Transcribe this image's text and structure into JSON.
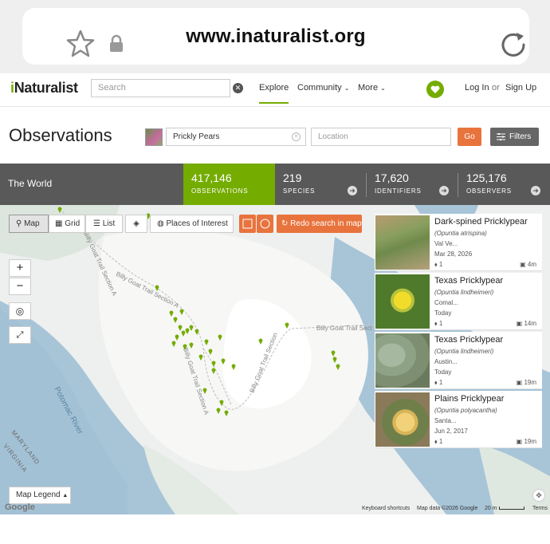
{
  "browser": {
    "url": "www.inaturalist.org"
  },
  "nav": {
    "logo_i": "i",
    "logo_rest": "Naturalist",
    "search_placeholder": "Search",
    "explore": "Explore",
    "community": "Community",
    "more": "More",
    "login": "Log In",
    "or": "or",
    "signup": "Sign Up"
  },
  "header": {
    "title": "Observations",
    "taxon_value": "Prickly Pears",
    "location_placeholder": "Location",
    "go": "Go",
    "filters": "Filters"
  },
  "stats": {
    "place": "The World",
    "observations": {
      "count": "417,146",
      "label": "OBSERVATIONS"
    },
    "species": {
      "count": "219",
      "label": "SPECIES"
    },
    "identifiers": {
      "count": "17,620",
      "label": "IDENTIFIERS"
    },
    "observers": {
      "count": "125,176",
      "label": "OBSERVERS"
    }
  },
  "map": {
    "views": {
      "map": "Map",
      "grid": "Grid",
      "list": "List"
    },
    "places_of_interest": "Places of Interest",
    "redo_search": "Redo search in map",
    "zoom_in": "+",
    "zoom_out": "−",
    "legend": "Map Legend",
    "google": "Google",
    "keyboard_shortcuts": "Keyboard shortcuts",
    "map_data": "Map data ©2026 Google",
    "scale": "20 m",
    "terms": "Terms",
    "labels": {
      "trail_a": "Billy Goat Trail Section A",
      "trail_b": "Billy Goat Trail Section",
      "trail_c": "Billy Goat Trail Sect",
      "trail_d": "Billy Goat Trail Section A",
      "trail_e": "Billy Goat Trail Section A",
      "river": "Potomac River",
      "maryland": "MARYLAND",
      "virginia": "VIRGINIA"
    }
  },
  "results": [
    {
      "name": "Dark-spined Pricklypear",
      "sci": "(Opuntia atrispina)",
      "place": "Val Ve...",
      "date": "Mar 28, 2026",
      "ids": "1",
      "age": "4m"
    },
    {
      "name": "Texas Pricklypear",
      "sci": "(Opuntia lindheimeri)",
      "place": "Comal...",
      "date": "Today",
      "ids": "1",
      "age": "14m"
    },
    {
      "name": "Texas Pricklypear",
      "sci": "(Opuntia lindheimeri)",
      "place": "Austin...",
      "date": "Today",
      "ids": "1",
      "age": "19m"
    },
    {
      "name": "Plains Pricklypear",
      "sci": "(Opuntia polyacantha)",
      "place": "Santa...",
      "date": "Jun 2, 2017",
      "ids": "1",
      "age": "19m"
    }
  ],
  "colors": {
    "brand_green": "#74ac00",
    "accent_orange": "#e8733d",
    "stats_bg": "#595959"
  }
}
